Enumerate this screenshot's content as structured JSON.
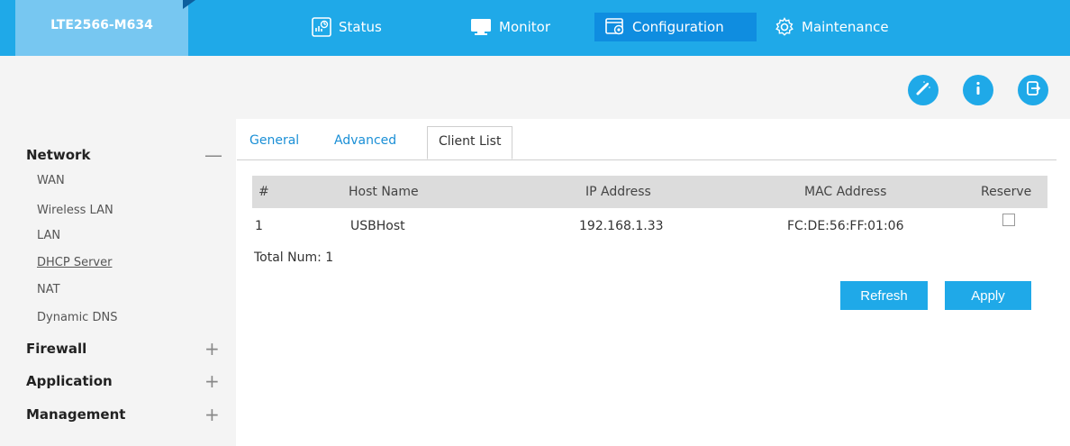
{
  "header": {
    "device_name": "LTE2566-M634",
    "nav": [
      {
        "label": "Status",
        "icon": "status-icon"
      },
      {
        "label": "Monitor",
        "icon": "monitor-icon"
      },
      {
        "label": "Configuration",
        "icon": "configuration-icon",
        "active": true
      },
      {
        "label": "Maintenance",
        "icon": "gear-icon"
      }
    ]
  },
  "toolbar": {
    "icons": [
      "wizard-icon",
      "info-icon",
      "logout-icon"
    ],
    "accent_color": "#1fa9e8"
  },
  "sidebar": {
    "sections": [
      {
        "label": "Network",
        "toggle": "—",
        "items": [
          "WAN",
          "Wireless LAN",
          "LAN",
          "DHCP Server",
          "NAT",
          "Dynamic DNS"
        ],
        "active_item": "DHCP Server"
      },
      {
        "label": "Firewall",
        "toggle": "+"
      },
      {
        "label": "Application",
        "toggle": "+"
      },
      {
        "label": "Management",
        "toggle": "+"
      }
    ]
  },
  "tabs": [
    {
      "label": "General"
    },
    {
      "label": "Advanced"
    },
    {
      "label": "Client List",
      "active": true
    }
  ],
  "table": {
    "columns": [
      "#",
      "Host Name",
      "IP Address",
      "MAC Address",
      "Reserve"
    ],
    "rows": [
      {
        "num": "1",
        "host": "USBHost",
        "ip": "192.168.1.33",
        "mac": "FC:DE:56:FF:01:06",
        "reserve": false
      }
    ],
    "total": "Total Num: 1"
  },
  "actions": {
    "refresh": "Refresh",
    "apply": "Apply"
  }
}
